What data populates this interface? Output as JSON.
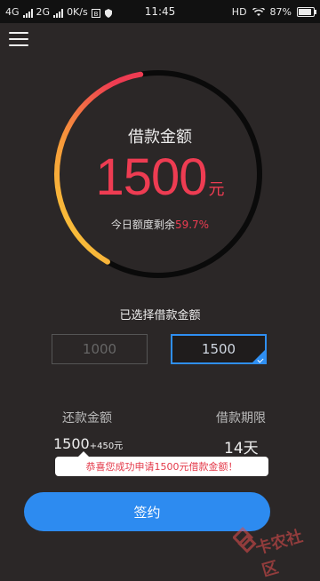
{
  "status_bar": {
    "network_1": "4G",
    "network_2": "2G",
    "speed": "0K/s",
    "time": "11:45",
    "hd": "HD",
    "battery": "87%",
    "battery_level": 0.87
  },
  "gauge": {
    "title": "借款金额",
    "amount": "1500",
    "unit": "元",
    "quota_label": "今日额度剩余",
    "quota_percent": "59.7%",
    "colors": {
      "track": "#0a0a0a",
      "start": "#f8d23a",
      "mid": "#f79a3a",
      "end": "#ee3c52"
    }
  },
  "selection": {
    "label": "已选择借款金额",
    "options": [
      {
        "label": "1000",
        "selected": false
      },
      {
        "label": "1500",
        "selected": true
      }
    ]
  },
  "summary": {
    "repay_label": "还款金额",
    "term_label": "借款期限",
    "repay_value": "1500",
    "repay_extra": "+450元",
    "term_value": "14天"
  },
  "toast": "恭喜您成功申请1500元借款金额！",
  "sign_button": "签约",
  "watermark": "卡农社区",
  "colors": {
    "accent": "#2d8bf0",
    "highlight": "#ee3c52",
    "background": "#2b2727"
  }
}
